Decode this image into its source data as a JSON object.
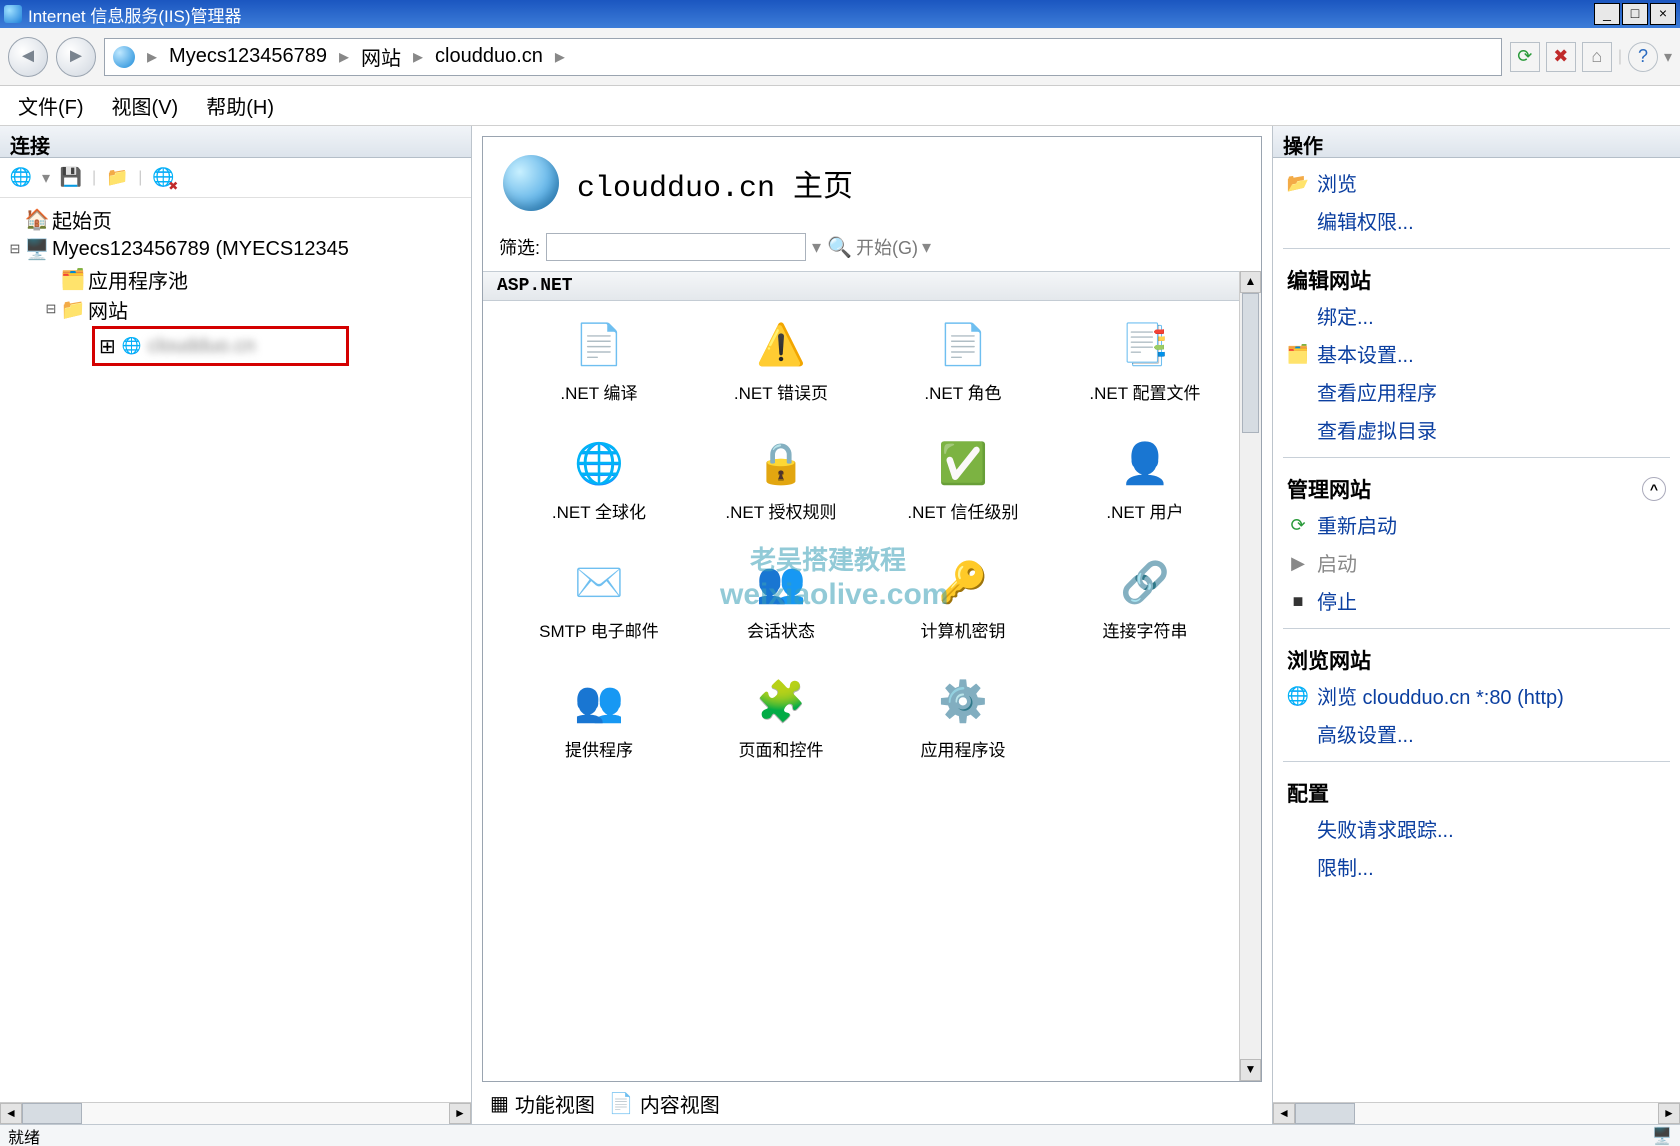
{
  "window": {
    "title": "Internet 信息服务(IIS)管理器"
  },
  "breadcrumb": {
    "root": "Myecs123456789",
    "level1": "网站",
    "level2": "cloudduo.cn"
  },
  "menu": {
    "file": "文件(F)",
    "view": "视图(V)",
    "help": "帮助(H)"
  },
  "connections": {
    "header": "连接",
    "startpage": "起始页",
    "server": "Myecs123456789 (MYECS12345",
    "apppools": "应用程序池",
    "sites": "网站",
    "selected_site": "cloudduo.cn"
  },
  "content": {
    "title": "cloudduo.cn 主页",
    "filter_label": "筛选:",
    "filter_value": "",
    "go_label": "开始(G)",
    "group_aspnet": "ASP.NET",
    "features": [
      ".NET 编译",
      ".NET 错误页",
      ".NET 角色",
      ".NET 配置文件",
      ".NET 全球化",
      ".NET 授权规则",
      ".NET 信任级别",
      ".NET 用户",
      "SMTP 电子邮件",
      "会话状态",
      "计算机密钥",
      "连接字符串",
      "提供程序",
      "页面和控件",
      "应用程序设"
    ],
    "view_features": "功能视图",
    "view_content": "内容视图"
  },
  "actions": {
    "header": "操作",
    "explore": "浏览",
    "edit_permissions": "编辑权限...",
    "edit_site_heading": "编辑网站",
    "bindings": "绑定...",
    "basic_settings": "基本设置...",
    "view_apps": "查看应用程序",
    "view_vdirs": "查看虚拟目录",
    "manage_heading": "管理网站",
    "restart": "重新启动",
    "start": "启动",
    "stop": "停止",
    "browse_heading": "浏览网站",
    "browse_80": "浏览 cloudduo.cn *:80 (http)",
    "advanced": "高级设置...",
    "config_heading": "配置",
    "failed_req": "失败请求跟踪...",
    "limits": "限制..."
  },
  "status": {
    "ready": "就绪"
  },
  "watermark": {
    "line1": "老吴搭建教程",
    "line2": "weixiaolive.com"
  }
}
